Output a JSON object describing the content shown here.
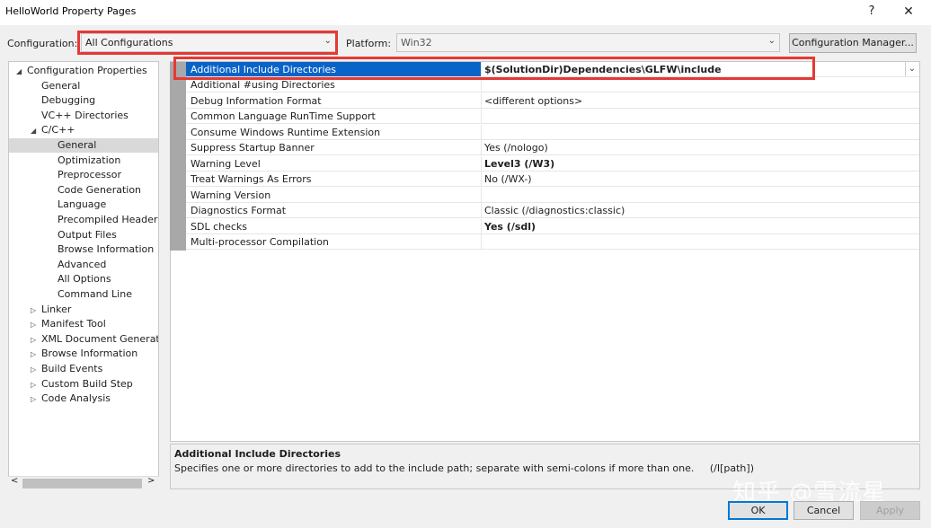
{
  "window": {
    "title": "HelloWorld Property Pages",
    "help_glyph": "?",
    "close_glyph": "✕"
  },
  "config_row": {
    "configuration_label": "Configuration:",
    "configuration_value": "All Configurations",
    "platform_label": "Platform:",
    "platform_value": "Win32",
    "config_manager_label": "Configuration Manager..."
  },
  "tree": {
    "items": [
      {
        "label": "Configuration Properties",
        "expander": "◢",
        "level": 0
      },
      {
        "label": "General",
        "expander": "",
        "level": 1
      },
      {
        "label": "Debugging",
        "expander": "",
        "level": 1
      },
      {
        "label": "VC++ Directories",
        "expander": "",
        "level": 1
      },
      {
        "label": "C/C++",
        "expander": "◢",
        "level": 1
      },
      {
        "label": "General",
        "expander": "",
        "level": 2,
        "selected": true
      },
      {
        "label": "Optimization",
        "expander": "",
        "level": 2
      },
      {
        "label": "Preprocessor",
        "expander": "",
        "level": 2
      },
      {
        "label": "Code Generation",
        "expander": "",
        "level": 2
      },
      {
        "label": "Language",
        "expander": "",
        "level": 2
      },
      {
        "label": "Precompiled Headers",
        "expander": "",
        "level": 2
      },
      {
        "label": "Output Files",
        "expander": "",
        "level": 2
      },
      {
        "label": "Browse Information",
        "expander": "",
        "level": 2
      },
      {
        "label": "Advanced",
        "expander": "",
        "level": 2
      },
      {
        "label": "All Options",
        "expander": "",
        "level": 2
      },
      {
        "label": "Command Line",
        "expander": "",
        "level": 2
      },
      {
        "label": "Linker",
        "expander": "▷",
        "level": 1
      },
      {
        "label": "Manifest Tool",
        "expander": "▷",
        "level": 1
      },
      {
        "label": "XML Document Generator",
        "expander": "▷",
        "level": 1
      },
      {
        "label": "Browse Information",
        "expander": "▷",
        "level": 1
      },
      {
        "label": "Build Events",
        "expander": "▷",
        "level": 1
      },
      {
        "label": "Custom Build Step",
        "expander": "▷",
        "level": 1
      },
      {
        "label": "Code Analysis",
        "expander": "▷",
        "level": 1
      }
    ],
    "scroll_left": "<",
    "scroll_right": ">"
  },
  "properties": [
    {
      "name": "Additional Include Directories",
      "value": "$(SolutionDir)Dependencies\\GLFW\\include",
      "bold": true,
      "selected": true
    },
    {
      "name": "Additional #using Directories",
      "value": ""
    },
    {
      "name": "Debug Information Format",
      "value": "<different options>"
    },
    {
      "name": "Common Language RunTime Support",
      "value": ""
    },
    {
      "name": "Consume Windows Runtime Extension",
      "value": ""
    },
    {
      "name": "Suppress Startup Banner",
      "value": "Yes (/nologo)"
    },
    {
      "name": "Warning Level",
      "value": "Level3 (/W3)",
      "bold": true
    },
    {
      "name": "Treat Warnings As Errors",
      "value": "No (/WX-)"
    },
    {
      "name": "Warning Version",
      "value": ""
    },
    {
      "name": "Diagnostics Format",
      "value": "Classic (/diagnostics:classic)"
    },
    {
      "name": "SDL checks",
      "value": "Yes (/sdl)",
      "bold": true
    },
    {
      "name": "Multi-processor Compilation",
      "value": ""
    }
  ],
  "description": {
    "title": "Additional Include Directories",
    "text": "Specifies one or more directories to add to the include path; separate with semi-colons if more than one.     (/I[path])"
  },
  "buttons": {
    "ok": "OK",
    "cancel": "Cancel",
    "apply": "Apply"
  },
  "watermark": "知乎 @雪流星",
  "colors": {
    "selection": "#0a64c8",
    "highlight_box": "#e53935"
  }
}
